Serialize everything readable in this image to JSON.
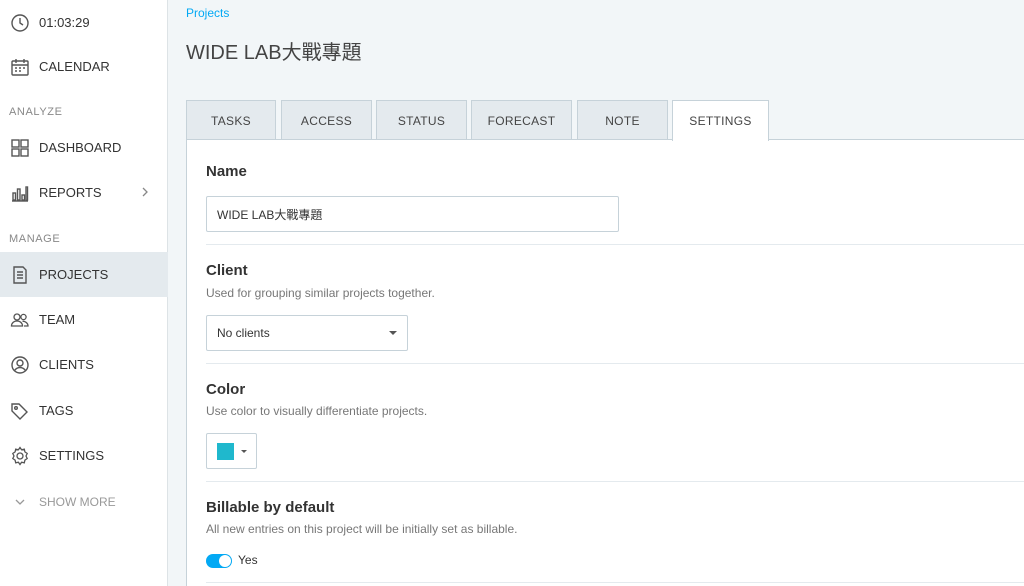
{
  "sidebar": {
    "timer": "01:03:29",
    "calendar": "CALENDAR",
    "analyze_label": "ANALYZE",
    "dashboard": "DASHBOARD",
    "reports": "REPORTS",
    "manage_label": "MANAGE",
    "projects": "PROJECTS",
    "team": "TEAM",
    "clients": "CLIENTS",
    "tags": "TAGS",
    "settings": "SETTINGS",
    "show_more": "SHOW MORE"
  },
  "header": {
    "breadcrumb": "Projects",
    "title": "WIDE LAB大戰專題"
  },
  "tabs": [
    "TASKS",
    "ACCESS",
    "STATUS",
    "FORECAST",
    "NOTE",
    "SETTINGS"
  ],
  "active_tab": "SETTINGS",
  "settings": {
    "name": {
      "label": "Name",
      "value": "WIDE LAB大戰專題"
    },
    "client": {
      "label": "Client",
      "description": "Used for grouping similar projects together.",
      "selected": "No clients"
    },
    "color": {
      "label": "Color",
      "description": "Use color to visually differentiate projects.",
      "value": "#1fb8cd"
    },
    "billable": {
      "label": "Billable by default",
      "description": "All new entries on this project will be initially set as billable.",
      "toggle_label": "Yes",
      "enabled": true
    }
  },
  "colors": {
    "accent": "#03a9f4",
    "toggle_on": "#03a9f4"
  }
}
